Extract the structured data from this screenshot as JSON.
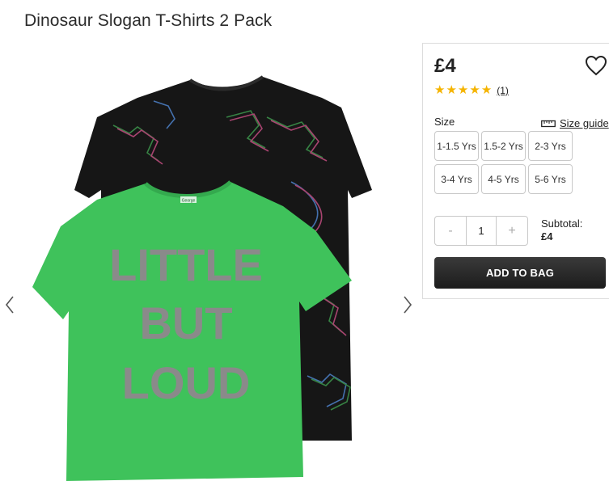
{
  "product": {
    "title": "Dinosaur Slogan T-Shirts 2 Pack",
    "price": "£4",
    "rating": 5,
    "review_count": "(1)",
    "image_print_text": [
      "LITTLE",
      "BUT",
      "LOUD"
    ],
    "image_label_text": "George"
  },
  "size": {
    "label": "Size",
    "guide_label": "Size guide",
    "options": [
      "1-1.5 Yrs",
      "1.5-2 Yrs",
      "2-3 Yrs",
      "3-4 Yrs",
      "4-5 Yrs",
      "5-6 Yrs"
    ]
  },
  "quantity": {
    "minus": "-",
    "value": "1",
    "plus": "+"
  },
  "subtotal": {
    "label": "Subtotal:",
    "amount": "£4"
  },
  "actions": {
    "add_to_bag": "ADD TO BAG"
  },
  "icons": {
    "wishlist": "heart-icon",
    "size_guide": "ruler-icon",
    "prev": "chevron-left-icon",
    "next": "chevron-right-icon",
    "star": "star-icon"
  },
  "colors": {
    "star": "#f5b400",
    "button": "#222222",
    "shirt_green": "#3fc25b",
    "shirt_black": "#161616"
  }
}
